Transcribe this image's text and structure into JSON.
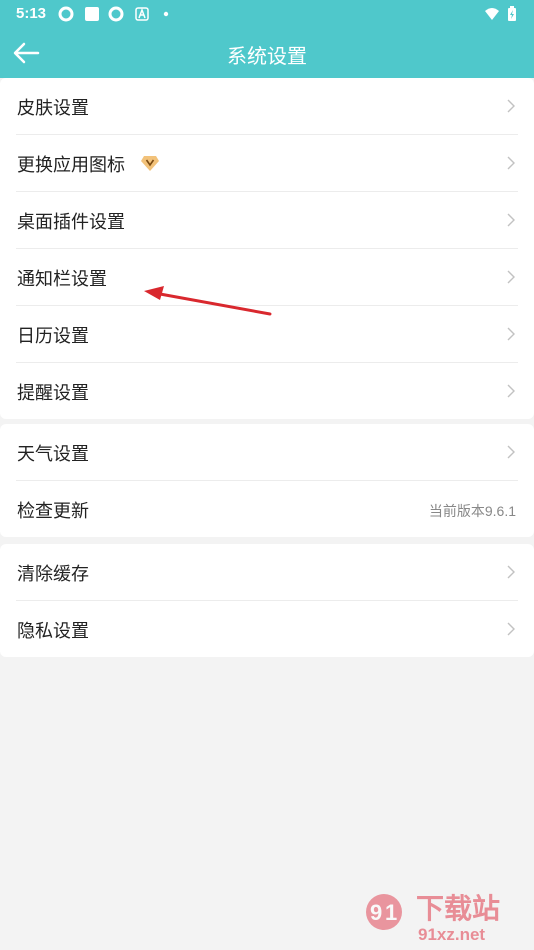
{
  "status": {
    "time": "5:13"
  },
  "header": {
    "title": "系统设置"
  },
  "groups": [
    {
      "items": [
        {
          "label": "皮肤设置"
        },
        {
          "label": "更换应用图标"
        },
        {
          "label": "桌面插件设置"
        },
        {
          "label": "通知栏设置"
        },
        {
          "label": "日历设置"
        },
        {
          "label": "提醒设置"
        }
      ]
    },
    {
      "items": [
        {
          "label": "天气设置"
        },
        {
          "label": "检查更新",
          "value": "当前版本9.6.1"
        }
      ]
    },
    {
      "items": [
        {
          "label": "清除缓存"
        },
        {
          "label": "隐私设置"
        }
      ]
    }
  ],
  "watermark": {
    "brand": "下载站",
    "domain": "91xz.net"
  },
  "colors": {
    "accent": "#4fc8cb",
    "annotation_arrow": "#d9282e"
  }
}
